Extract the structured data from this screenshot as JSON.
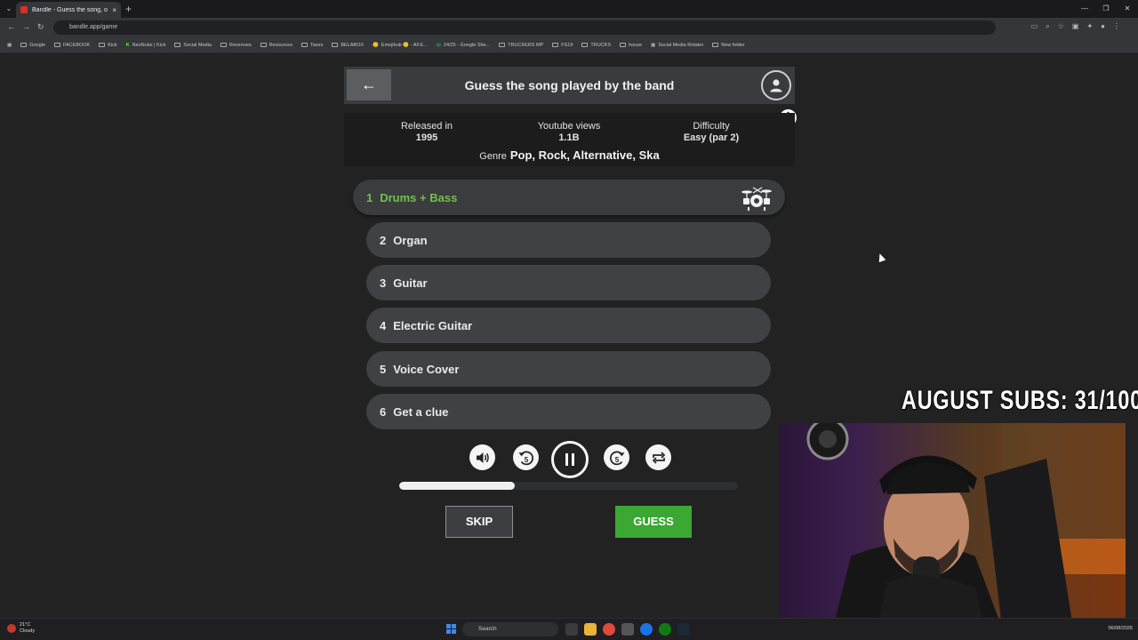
{
  "browser": {
    "tab_title": "Bandle - Guess the song, o",
    "tab_close": "×",
    "new_tab": "+",
    "url": "bandle.app/game",
    "bookmarks": [
      "Google",
      "FACEBOOK",
      "Kick",
      "NeoNuke | Kick",
      "Social Media",
      "Revenues",
      "Resources",
      "Taxes",
      "BELABOX",
      "Emojihub 🙂 - All E...",
      "24/25 - Google She...",
      "TRUCKERS MP",
      "FS19",
      "TRUCKS",
      "house",
      "Social Media Rotator",
      "New folder"
    ]
  },
  "game": {
    "back_arrow": "←",
    "title": "Guess the song played by the band",
    "info": {
      "released_label": "Released in",
      "released_value": "1995",
      "views_label": "Youtube views",
      "views_value": "1.1B",
      "difficulty_label": "Difficulty",
      "difficulty_value": "Easy (par 2)",
      "genre_label": "Genre",
      "genre_value": "Pop, Rock, Alternative, Ska"
    },
    "clues": [
      {
        "num": "1",
        "label": "Drums + Bass"
      },
      {
        "num": "2",
        "label": "Organ"
      },
      {
        "num": "3",
        "label": "Guitar"
      },
      {
        "num": "4",
        "label": "Electric Guitar"
      },
      {
        "num": "5",
        "label": "Voice Cover"
      },
      {
        "num": "6",
        "label": "Get a clue"
      }
    ],
    "progress_fraction": 0.34,
    "skip_label": "SKIP",
    "guess_label": "GUESS",
    "rewind_seconds": "5",
    "forward_seconds": "5"
  },
  "overlay": {
    "subs_text": "AUGUST SUBS: 31/100"
  },
  "taskbar": {
    "temp": "21°C",
    "weather": "Cloudy",
    "search": "Search",
    "date": "06/08/2025"
  },
  "colors": {
    "accent_green": "#71c14d",
    "guess_green": "#3aa832"
  }
}
